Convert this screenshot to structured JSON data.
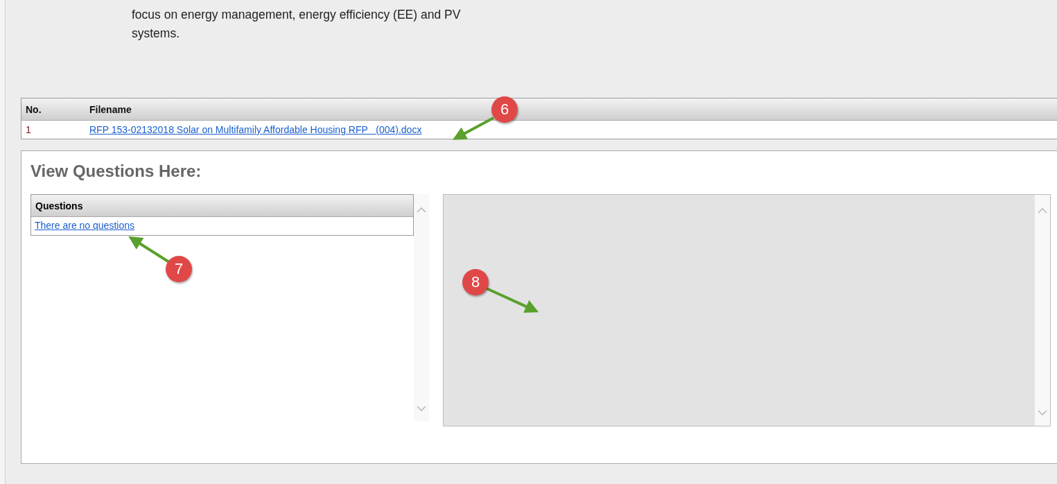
{
  "description": {
    "lines": [
      "focus on energy management, energy efficiency (EE) and PV",
      "systems."
    ]
  },
  "files": {
    "columns": [
      "No.",
      "Filename"
    ],
    "rows": [
      {
        "no": "1",
        "filename": "RFP 153-02132018 Solar on Multifamily Affordable Housing RFP   (004).docx"
      }
    ]
  },
  "questions_section": {
    "title": "View Questions Here:",
    "list_header": "Questions",
    "empty_link": "There are no questions"
  },
  "callouts": [
    {
      "label": "6"
    },
    {
      "label": "7"
    },
    {
      "label": "8"
    }
  ]
}
